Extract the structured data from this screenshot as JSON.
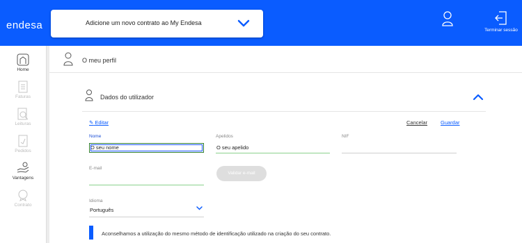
{
  "header": {
    "logo": "endesa",
    "contract_selector": "Adicione um novo contrato ao My Endesa",
    "logout_label": "Terminar sessão",
    "background_color": "#0a5cff"
  },
  "sidebar": {
    "items": [
      {
        "label": "Home",
        "icon": "home-icon",
        "enabled": true
      },
      {
        "label": "Faturas",
        "icon": "invoice-icon",
        "enabled": false
      },
      {
        "label": "Leituras",
        "icon": "meter-reading-icon",
        "enabled": false
      },
      {
        "label": "Pedidos",
        "icon": "requests-icon",
        "enabled": false
      },
      {
        "label": "Vantagens",
        "icon": "benefits-icon",
        "enabled": true
      },
      {
        "label": "Contrato",
        "icon": "contract-icon",
        "enabled": false
      }
    ]
  },
  "profile": {
    "title": "O meu perfil"
  },
  "user_data": {
    "section_title": "Dados do utilizador",
    "edit_label": "Editar",
    "cancel_label": "Cancelar",
    "save_label": "Guardar",
    "fields": {
      "nome": {
        "label": "Nome",
        "value": "O seu nome"
      },
      "apelidos": {
        "label": "Apelidos",
        "value": "O seu apelido"
      },
      "nif": {
        "label": "NIF",
        "value": ""
      },
      "email": {
        "label": "E-mail",
        "value": ""
      },
      "idioma": {
        "label": "Idioma",
        "value": "Português"
      }
    },
    "validate_email_label": "Validar e-mail",
    "notice": "Aconselhamos a utilização do mesmo método de identificação utilizado na criação do seu contrato."
  }
}
